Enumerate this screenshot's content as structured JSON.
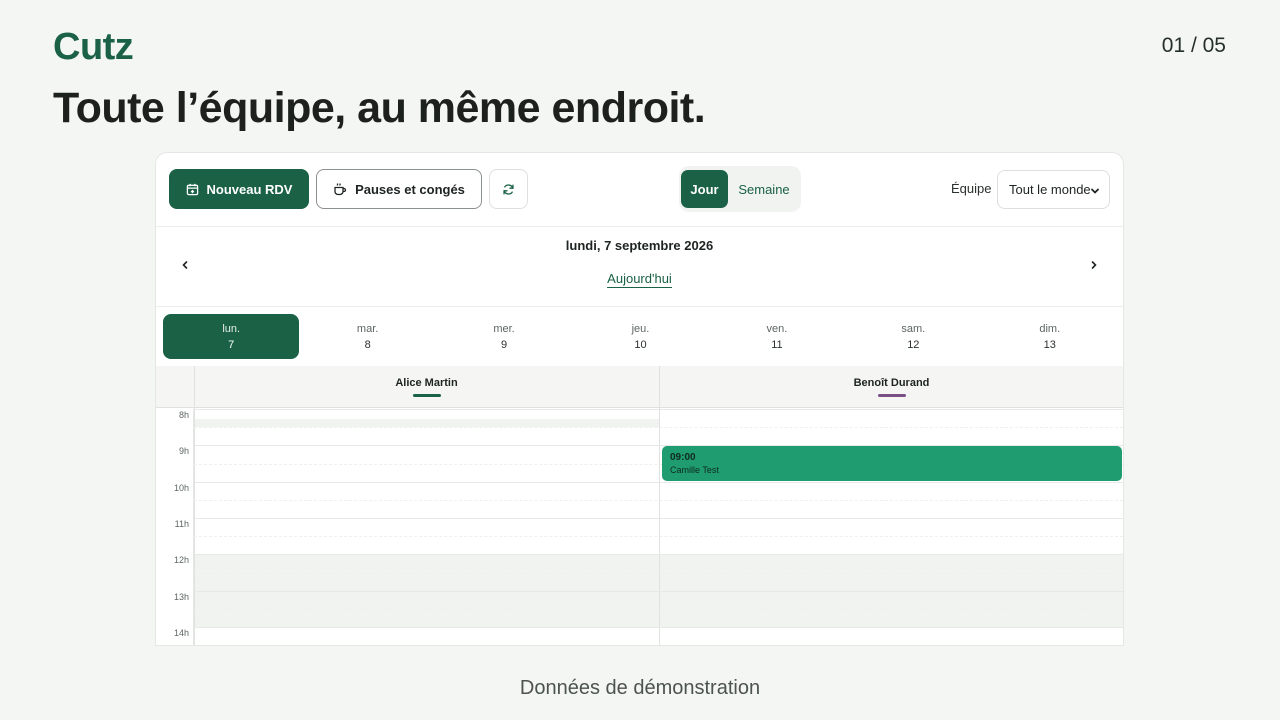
{
  "brand": "Cutz",
  "pager": "01 / 05",
  "headline": "Toute l’équipe, au même endroit.",
  "footer_note": "Données de démonstration",
  "toolbar": {
    "new_appointment": "Nouveau RDV",
    "breaks": "Pauses et congés",
    "view_day": "Jour",
    "view_week": "Semaine",
    "team_label": "Équipe",
    "team_selected": "Tout le monde"
  },
  "date_nav": {
    "current_date": "lundi, 7 septembre 2026",
    "today": "Aujourd'hui"
  },
  "days": [
    {
      "name": "lun.",
      "num": "7",
      "active": true
    },
    {
      "name": "mar.",
      "num": "8"
    },
    {
      "name": "mer.",
      "num": "9"
    },
    {
      "name": "jeu.",
      "num": "10"
    },
    {
      "name": "ven.",
      "num": "11"
    },
    {
      "name": "sam.",
      "num": "12"
    },
    {
      "name": "dim.",
      "num": "13"
    }
  ],
  "staff": [
    {
      "name": "Alice Martin",
      "color": "#1a6146"
    },
    {
      "name": "Benoît Durand",
      "color": "#7b4f86"
    }
  ],
  "hours": [
    "8h",
    "9h",
    "10h",
    "11h",
    "12h",
    "13h",
    "14h"
  ],
  "event": {
    "time": "09:00",
    "client": "Camille Test",
    "color": "#1f9c70"
  },
  "colors": {
    "brand": "#1a6146",
    "background": "#f4f6f3"
  }
}
